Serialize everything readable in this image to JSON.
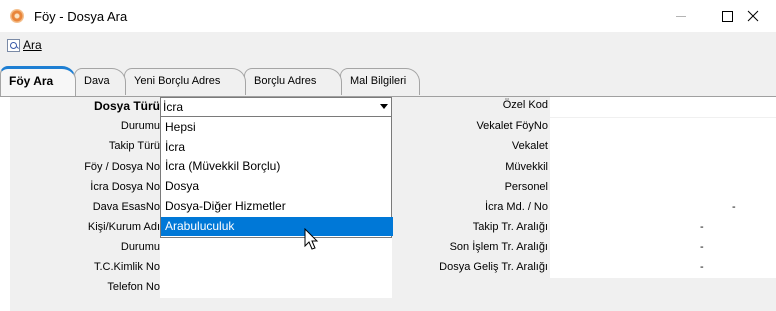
{
  "window": {
    "title": "Föy - Dosya Ara"
  },
  "toolbar": {
    "search_label": "Ara"
  },
  "tabs": [
    {
      "label": "Föy Ara",
      "active": true
    },
    {
      "label": "Dava"
    },
    {
      "label": "Yeni Borçlu Adres"
    },
    {
      "label": "Borçlu Adres"
    },
    {
      "label": "Mal Bilgileri"
    }
  ],
  "left_form": {
    "labels": [
      "Dosya Türü",
      "Durumu",
      "Takip Türü",
      "Föy / Dosya No",
      "İcra Dosya No",
      "Dava EsasNo",
      "Kişi/Kurum Adı",
      "Durumu",
      "T.C.Kimlik No",
      "Telefon No"
    ],
    "dosya_turu_value": "İcra"
  },
  "dropdown": {
    "options": [
      "Hepsi",
      "İcra",
      "İcra (Müvekkil Borçlu)",
      "Dosya",
      "Dosya-Diğer Hizmetler",
      "Arabuluculuk"
    ],
    "highlighted": "Arabuluculuk"
  },
  "right_form": {
    "labels": [
      "Özel Kod",
      "Vekalet FöyNo",
      "Vekalet",
      "Müvekkil",
      "Personel",
      "İcra Md. / No",
      "Takip Tr. Aralığı",
      "Son İşlem Tr. Aralığı",
      "Dosya Geliş Tr. Aralığı"
    ],
    "range_separator": "-"
  }
}
